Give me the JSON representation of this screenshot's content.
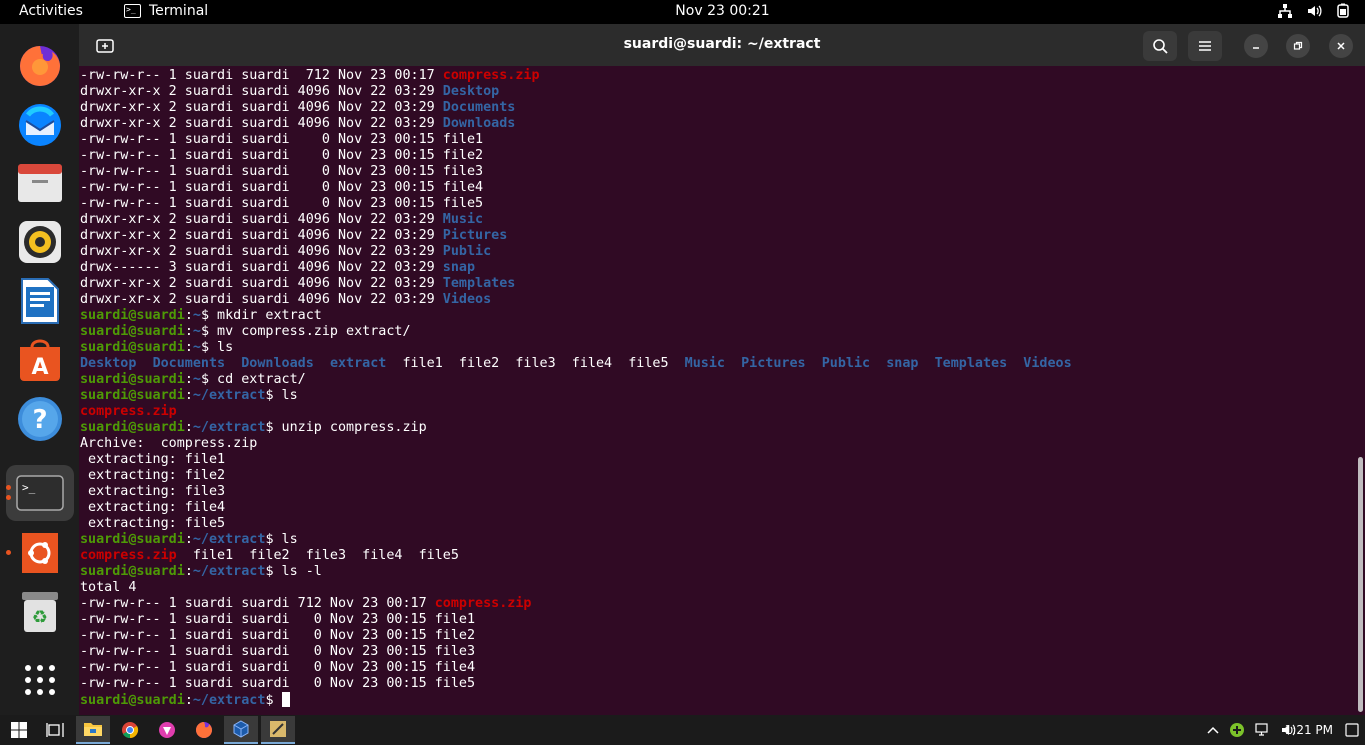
{
  "topbar": {
    "activities": "Activities",
    "app_name": "Terminal",
    "clock": "Nov 23  00:21"
  },
  "window": {
    "title": "suardi@suardi: ~/extract"
  },
  "dock": {
    "apps": [
      "firefox",
      "thunderbird",
      "files",
      "rhythmbox",
      "libreoffice-writer",
      "ubuntu-software",
      "help",
      "terminal",
      "ubuntu-installer",
      "trash",
      "show-applications"
    ]
  },
  "terminal": {
    "lines": [
      [
        {
          "t": "-rw-rw-r-- 1 suardi suardi  712 Nov 23 00:17 "
        },
        {
          "t": "compress.zip",
          "c": "red"
        }
      ],
      [
        {
          "t": "drwxr-xr-x 2 suardi suardi 4096 Nov 22 03:29 "
        },
        {
          "t": "Desktop",
          "c": "blue"
        }
      ],
      [
        {
          "t": "drwxr-xr-x 2 suardi suardi 4096 Nov 22 03:29 "
        },
        {
          "t": "Documents",
          "c": "blue"
        }
      ],
      [
        {
          "t": "drwxr-xr-x 2 suardi suardi 4096 Nov 22 03:29 "
        },
        {
          "t": "Downloads",
          "c": "blue"
        }
      ],
      [
        {
          "t": "-rw-rw-r-- 1 suardi suardi    0 Nov 23 00:15 file1"
        }
      ],
      [
        {
          "t": "-rw-rw-r-- 1 suardi suardi    0 Nov 23 00:15 file2"
        }
      ],
      [
        {
          "t": "-rw-rw-r-- 1 suardi suardi    0 Nov 23 00:15 file3"
        }
      ],
      [
        {
          "t": "-rw-rw-r-- 1 suardi suardi    0 Nov 23 00:15 file4"
        }
      ],
      [
        {
          "t": "-rw-rw-r-- 1 suardi suardi    0 Nov 23 00:15 file5"
        }
      ],
      [
        {
          "t": "drwxr-xr-x 2 suardi suardi 4096 Nov 22 03:29 "
        },
        {
          "t": "Music",
          "c": "blue"
        }
      ],
      [
        {
          "t": "drwxr-xr-x 2 suardi suardi 4096 Nov 22 03:29 "
        },
        {
          "t": "Pictures",
          "c": "blue"
        }
      ],
      [
        {
          "t": "drwxr-xr-x 2 suardi suardi 4096 Nov 22 03:29 "
        },
        {
          "t": "Public",
          "c": "blue"
        }
      ],
      [
        {
          "t": "drwx------ 3 suardi suardi 4096 Nov 22 03:29 "
        },
        {
          "t": "snap",
          "c": "blue"
        }
      ],
      [
        {
          "t": "drwxr-xr-x 2 suardi suardi 4096 Nov 22 03:29 "
        },
        {
          "t": "Templates",
          "c": "blue"
        }
      ],
      [
        {
          "t": "drwxr-xr-x 2 suardi suardi 4096 Nov 22 03:29 "
        },
        {
          "t": "Videos",
          "c": "blue"
        }
      ],
      [
        {
          "t": "suardi@suardi",
          "c": "green"
        },
        {
          "t": ":"
        },
        {
          "t": "~",
          "c": "pblue"
        },
        {
          "t": "$ mkdir extract"
        }
      ],
      [
        {
          "t": "suardi@suardi",
          "c": "green"
        },
        {
          "t": ":"
        },
        {
          "t": "~",
          "c": "pblue"
        },
        {
          "t": "$ mv compress.zip extract/"
        }
      ],
      [
        {
          "t": "suardi@suardi",
          "c": "green"
        },
        {
          "t": ":"
        },
        {
          "t": "~",
          "c": "pblue"
        },
        {
          "t": "$ ls"
        }
      ],
      [
        {
          "t": "Desktop",
          "c": "blue"
        },
        {
          "t": "  "
        },
        {
          "t": "Documents",
          "c": "blue"
        },
        {
          "t": "  "
        },
        {
          "t": "Downloads",
          "c": "blue"
        },
        {
          "t": "  "
        },
        {
          "t": "extract",
          "c": "blue"
        },
        {
          "t": "  file1  file2  file3  file4  file5  "
        },
        {
          "t": "Music",
          "c": "blue"
        },
        {
          "t": "  "
        },
        {
          "t": "Pictures",
          "c": "blue"
        },
        {
          "t": "  "
        },
        {
          "t": "Public",
          "c": "blue"
        },
        {
          "t": "  "
        },
        {
          "t": "snap",
          "c": "blue"
        },
        {
          "t": "  "
        },
        {
          "t": "Templates",
          "c": "blue"
        },
        {
          "t": "  "
        },
        {
          "t": "Videos",
          "c": "blue"
        }
      ],
      [
        {
          "t": "suardi@suardi",
          "c": "green"
        },
        {
          "t": ":"
        },
        {
          "t": "~",
          "c": "pblue"
        },
        {
          "t": "$ cd extract/"
        }
      ],
      [
        {
          "t": "suardi@suardi",
          "c": "green"
        },
        {
          "t": ":"
        },
        {
          "t": "~/extract",
          "c": "pblue"
        },
        {
          "t": "$ ls"
        }
      ],
      [
        {
          "t": "compress.zip",
          "c": "red"
        }
      ],
      [
        {
          "t": "suardi@suardi",
          "c": "green"
        },
        {
          "t": ":"
        },
        {
          "t": "~/extract",
          "c": "pblue"
        },
        {
          "t": "$ unzip compress.zip"
        }
      ],
      [
        {
          "t": "Archive:  compress.zip"
        }
      ],
      [
        {
          "t": " extracting: file1"
        }
      ],
      [
        {
          "t": " extracting: file2"
        }
      ],
      [
        {
          "t": " extracting: file3"
        }
      ],
      [
        {
          "t": " extracting: file4"
        }
      ],
      [
        {
          "t": " extracting: file5"
        }
      ],
      [
        {
          "t": "suardi@suardi",
          "c": "green"
        },
        {
          "t": ":"
        },
        {
          "t": "~/extract",
          "c": "pblue"
        },
        {
          "t": "$ ls"
        }
      ],
      [
        {
          "t": "compress.zip",
          "c": "red"
        },
        {
          "t": "  file1  file2  file3  file4  file5"
        }
      ],
      [
        {
          "t": "suardi@suardi",
          "c": "green"
        },
        {
          "t": ":"
        },
        {
          "t": "~/extract",
          "c": "pblue"
        },
        {
          "t": "$ ls -l"
        }
      ],
      [
        {
          "t": "total 4"
        }
      ],
      [
        {
          "t": "-rw-rw-r-- 1 suardi suardi 712 Nov 23 00:17 "
        },
        {
          "t": "compress.zip",
          "c": "red"
        }
      ],
      [
        {
          "t": "-rw-rw-r-- 1 suardi suardi   0 Nov 23 00:15 file1"
        }
      ],
      [
        {
          "t": "-rw-rw-r-- 1 suardi suardi   0 Nov 23 00:15 file2"
        }
      ],
      [
        {
          "t": "-rw-rw-r-- 1 suardi suardi   0 Nov 23 00:15 file3"
        }
      ],
      [
        {
          "t": "-rw-rw-r-- 1 suardi suardi   0 Nov 23 00:15 file4"
        }
      ],
      [
        {
          "t": "-rw-rw-r-- 1 suardi suardi   0 Nov 23 00:15 file5"
        }
      ],
      [
        {
          "t": "suardi@suardi",
          "c": "green"
        },
        {
          "t": ":"
        },
        {
          "t": "~/extract",
          "c": "pblue"
        },
        {
          "t": "$ "
        },
        {
          "cursor": true
        }
      ]
    ]
  },
  "taskbar": {
    "clock": "1:21 PM",
    "apps": [
      "windows-start",
      "task-view",
      "file-explorer",
      "chrome",
      "brave",
      "firefox",
      "virtualbox",
      "active-app"
    ]
  },
  "colors": {
    "terminal_bg": "#300a24",
    "prompt_user": "#4e9a06",
    "directory": "#3465a4",
    "archive": "#cc0000",
    "ubuntu_orange": "#e95420"
  }
}
